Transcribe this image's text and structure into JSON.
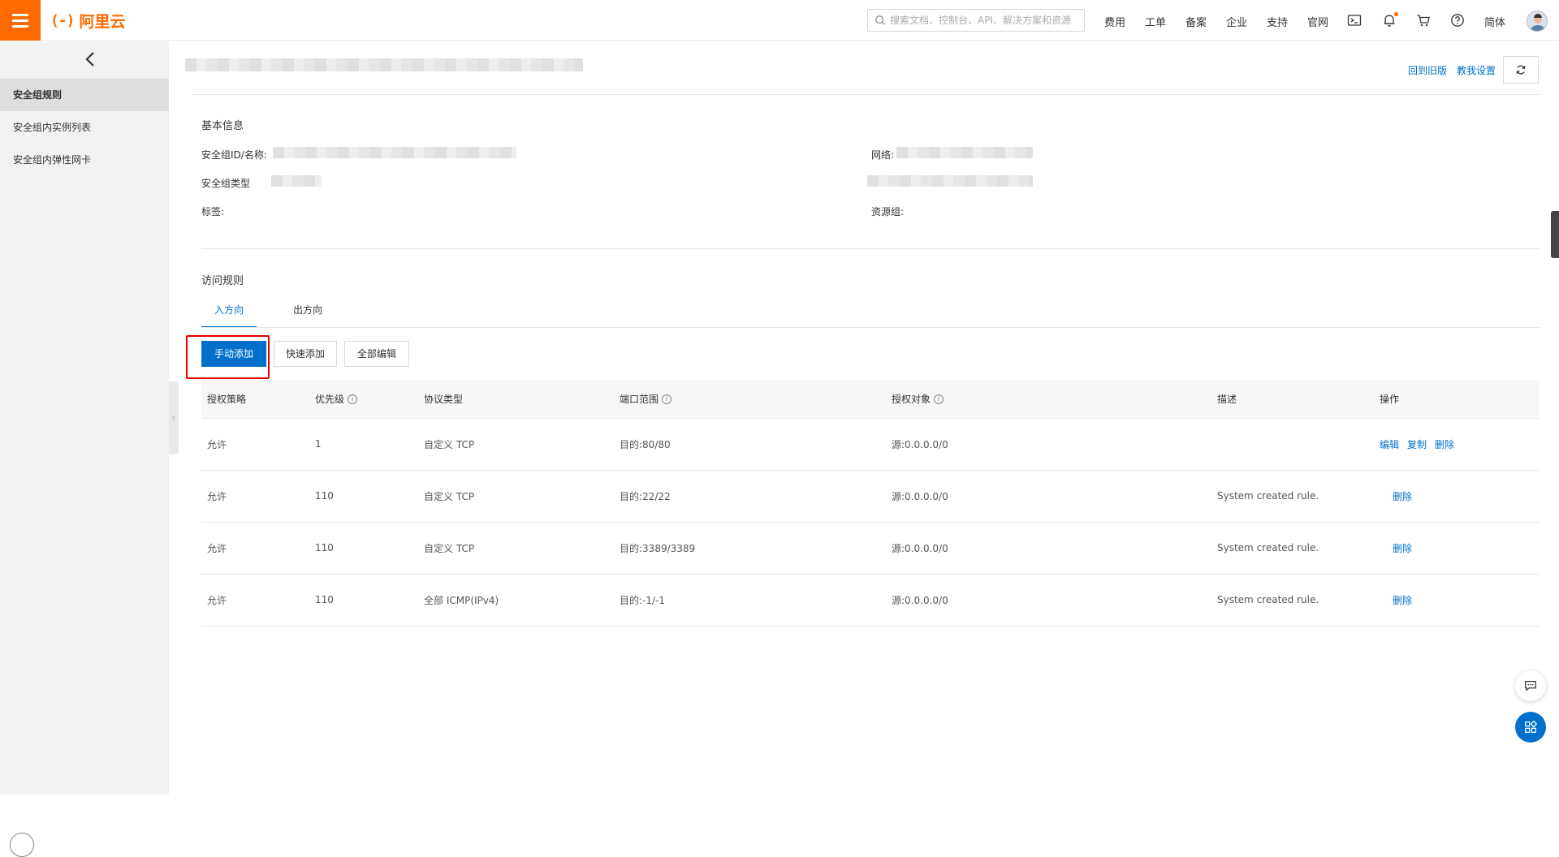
{
  "topbar": {
    "logo_mark": "(-)",
    "logo_text": "阿里云",
    "search_placeholder": "搜索文档、控制台、API、解决方案和资源",
    "nav": [
      "费用",
      "工单",
      "备案",
      "企业",
      "支持",
      "官网"
    ],
    "lang": "简体",
    "icons": [
      "terminal-icon",
      "bell-icon",
      "cart-icon",
      "help-icon"
    ],
    "accent": "#ff6a00"
  },
  "sidebar": {
    "items": [
      {
        "label": "安全组规则",
        "active": true
      },
      {
        "label": "安全组内实例列表",
        "active": false
      },
      {
        "label": "安全组内弹性网卡",
        "active": false
      }
    ]
  },
  "header": {
    "back_old": "回到旧版",
    "teach_settings": "教我设置"
  },
  "basic_info": {
    "title": "基本信息",
    "sg_id_label": "安全组ID/名称:",
    "network_label": "网络:",
    "sg_type_label": "安全组类型",
    "tag_label": "标签:",
    "resource_group_label": "资源组:"
  },
  "rules": {
    "title": "访问规则",
    "tabs": [
      "入方向",
      "出方向"
    ],
    "buttons": {
      "manual_add": "手动添加",
      "quick_add": "快速添加",
      "edit_all": "全部编辑"
    },
    "columns": [
      "授权策略",
      "优先级",
      "协议类型",
      "端口范围",
      "授权对象",
      "描述",
      "操作"
    ],
    "rows": [
      {
        "policy": "允许",
        "priority": "1",
        "protocol": "自定义 TCP",
        "port": "目的:80/80",
        "source": "源:0.0.0.0/0",
        "desc": "",
        "ops": [
          "编辑",
          "复制",
          "删除"
        ]
      },
      {
        "policy": "允许",
        "priority": "110",
        "protocol": "自定义 TCP",
        "port": "目的:22/22",
        "source": "源:0.0.0.0/0",
        "desc": "System created rule.",
        "ops": [
          "删除"
        ]
      },
      {
        "policy": "允许",
        "priority": "110",
        "protocol": "自定义 TCP",
        "port": "目的:3389/3389",
        "source": "源:0.0.0.0/0",
        "desc": "System created rule.",
        "ops": [
          "删除"
        ]
      },
      {
        "policy": "允许",
        "priority": "110",
        "protocol": "全部 ICMP(IPv4)",
        "port": "目的:-1/-1",
        "source": "源:0.0.0.0/0",
        "desc": "System created rule.",
        "ops": [
          "删除"
        ]
      }
    ]
  },
  "colors": {
    "primary": "#0070cc",
    "highlight": "#e60000"
  }
}
